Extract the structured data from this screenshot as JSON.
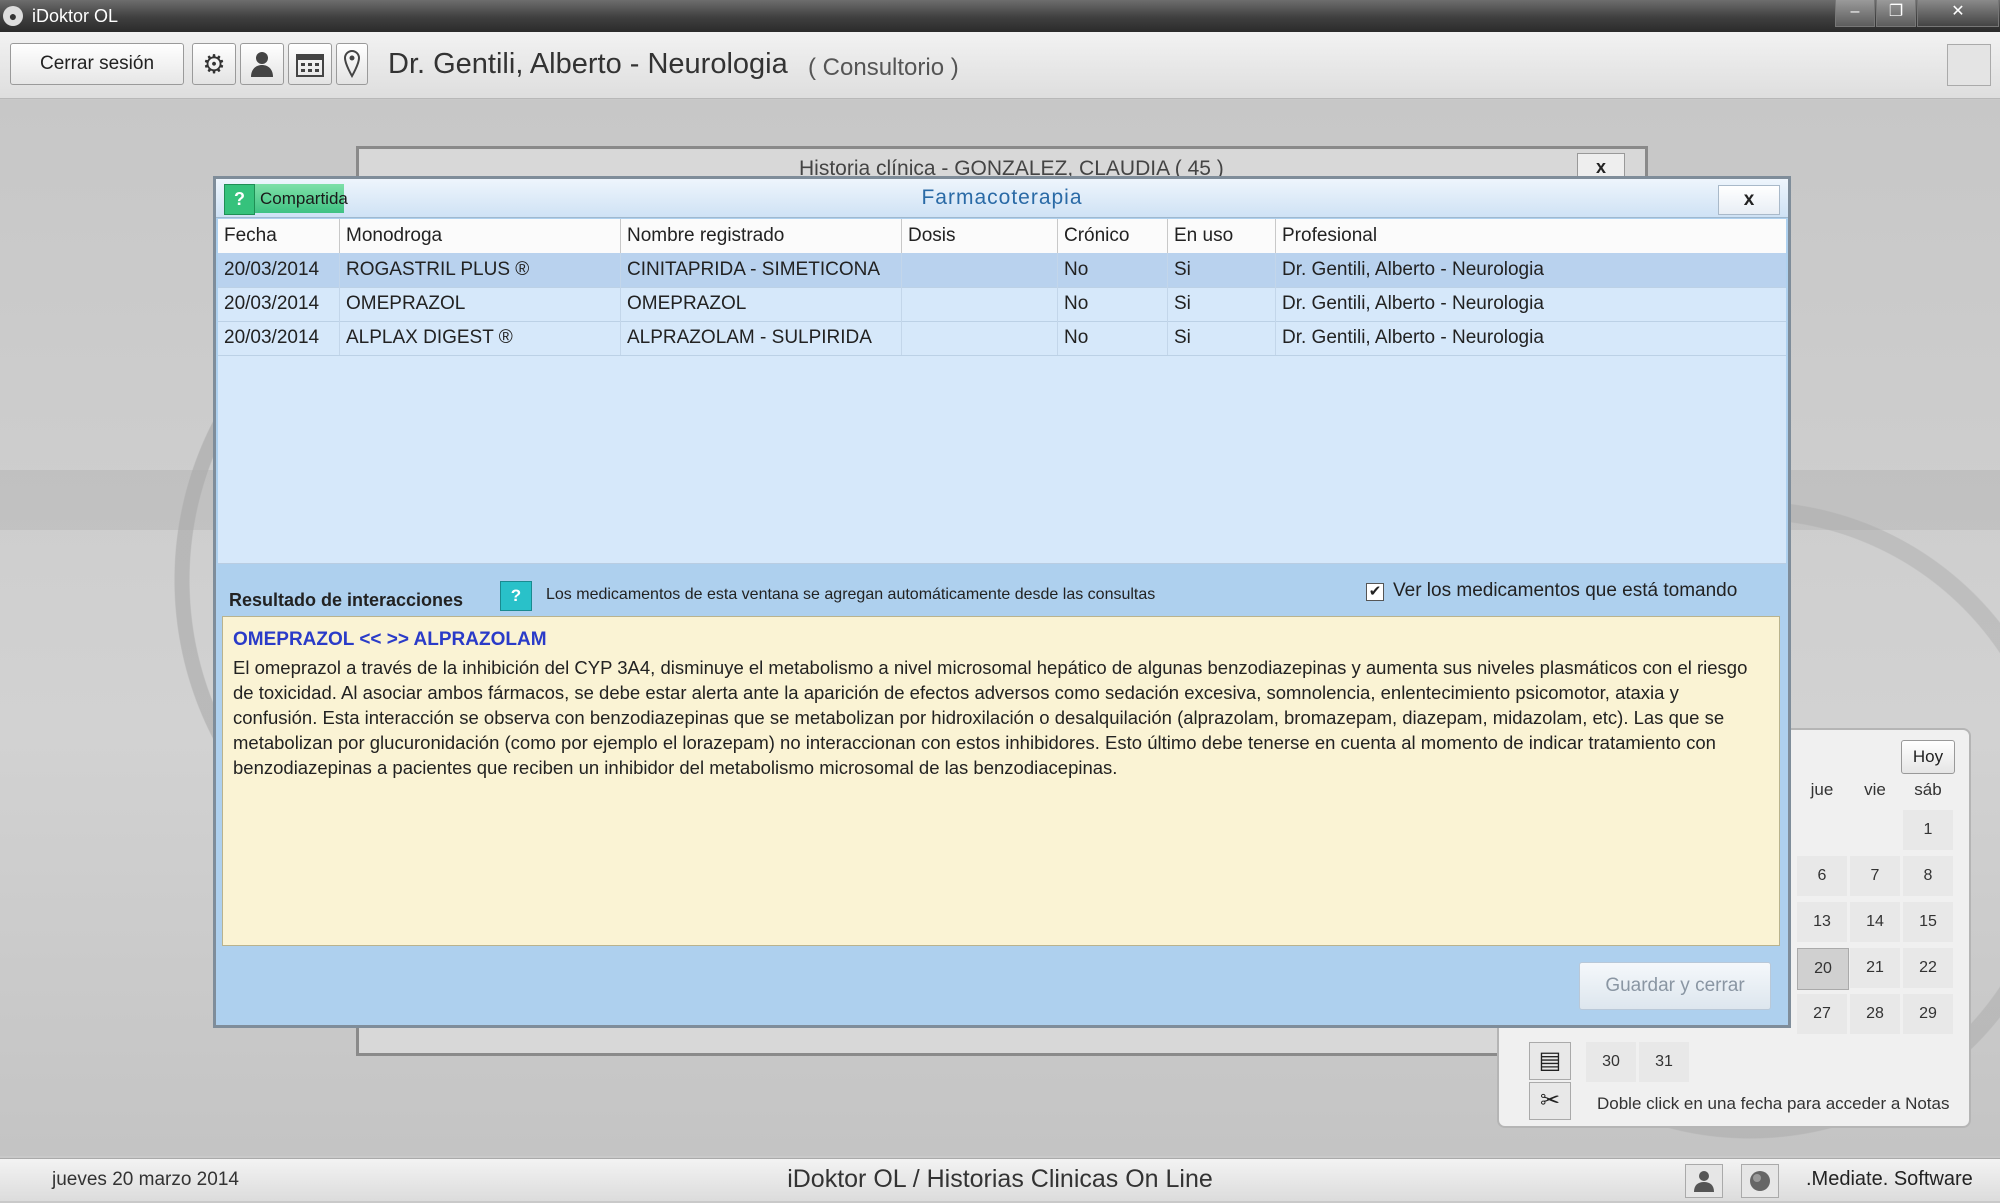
{
  "window": {
    "title": "iDoktor OL",
    "minimize": "–",
    "maximize": "❐",
    "close": "✕"
  },
  "toolbar": {
    "logout_label": "Cerrar sesión",
    "doctor": "Dr. Gentili, Alberto - Neurologia",
    "context": "( Consultorio )",
    "icons": [
      "gear-icon",
      "user-icon",
      "calendar-icon",
      "location-pin-icon"
    ]
  },
  "background_window": {
    "title": "Historia clínica - GONZALEZ, CLAUDIA ( 45 )",
    "close": "x"
  },
  "dialog": {
    "shared_label": "Compartida",
    "help": "?",
    "title": "Farmacoterapia",
    "close": "x",
    "columns": [
      "Fecha",
      "Monodroga",
      "Nombre registrado",
      "Dosis",
      "Crónico",
      "En uso",
      "Profesional"
    ],
    "rows": [
      [
        "20/03/2014",
        "ROGASTRIL PLUS ®",
        "CINITAPRIDA - SIMETICONA",
        "",
        "No",
        "Si",
        "Dr. Gentili, Alberto - Neurologia"
      ],
      [
        "20/03/2014",
        "OMEPRAZOL",
        "OMEPRAZOL",
        "",
        "No",
        "Si",
        "Dr. Gentili, Alberto - Neurologia"
      ],
      [
        "20/03/2014",
        "ALPLAX DIGEST ®",
        "ALPRAZOLAM - SULPIRIDA",
        "",
        "No",
        "Si",
        "Dr. Gentili, Alberto - Neurologia"
      ]
    ],
    "results_label": "Resultado de interacciones",
    "info_help": "?",
    "info_text": "Los medicamentos de esta ventana se agregan automáticamente desde las consultas",
    "checkbox_label": "Ver los medicamentos que está tomando",
    "checkbox_checked": true,
    "interaction_title": "OMEPRAZOL << >> ALPRAZOLAM",
    "interaction_body": "El omeprazol a través de la inhibición del  CYP 3A4,  disminuye el metabolismo a nivel microsomal hepático de algunas benzodiazepinas y aumenta  sus  niveles plasmáticos con el riesgo de toxicidad. Al asociar ambos fármacos, se debe estar alerta ante la aparición de efectos adversos como sedación excesiva, somnolencia, enlentecimiento psicomotor, ataxia y confusión. Esta interacción se observa con benzodiazepinas que se metabolizan por hidroxilación o desalquilación (alprazolam, bromazepam, diazepam, midazolam, etc). Las que se metabolizan por glucuronidación (como por ejemplo el lorazepam) no interaccionan con estos inhibidores. Esto último debe tenerse en cuenta al momento de indicar tratamiento con benzodiazepinas a pacientes que reciben un inhibidor del metabolismo microsomal de las benzodiacepinas.",
    "save_label": "Guardar y cerrar"
  },
  "calendar": {
    "today_button": "Hoy",
    "headers": [
      "jue",
      "vie",
      "sáb"
    ],
    "days": [
      "1",
      "6",
      "7",
      "8",
      "13",
      "14",
      "15",
      "20",
      "21",
      "22",
      "27",
      "28",
      "29",
      "30",
      "31"
    ],
    "selected": "20",
    "footer": "Doble click en una fecha para acceder a Notas",
    "tools": [
      "notes-icon",
      "tools-icon"
    ]
  },
  "statusbar": {
    "date": "jueves 20 marzo 2014",
    "center": "iDoktor OL  /  Historias Clinicas On Line",
    "brand": ".Mediate. Software",
    "icons": [
      "user-icon",
      "globe-icon"
    ]
  }
}
